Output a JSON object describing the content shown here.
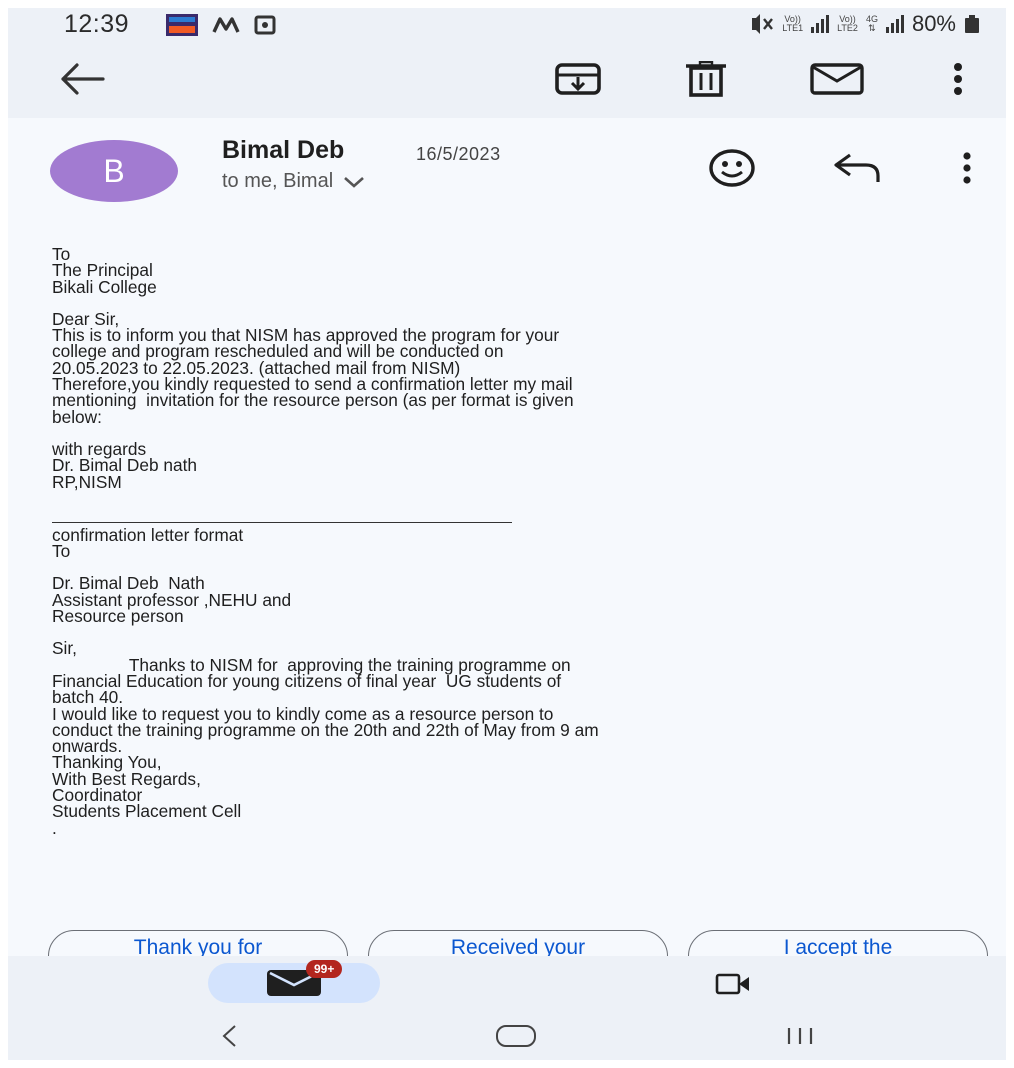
{
  "status_bar": {
    "time": "12:39",
    "network_top_1": "Vo))",
    "network_bottom_1": "LTE1",
    "network_top_2": "Vo))",
    "network_bottom_2": "LTE2",
    "network_gen": "4G",
    "battery_percent": "80%"
  },
  "toolbar": {
    "icons": [
      "back-arrow-icon",
      "archive-icon",
      "delete-icon",
      "mark-unread-icon",
      "more-vert-icon"
    ]
  },
  "message": {
    "avatar_letter": "B",
    "avatar_color": "#a27bd1",
    "sender": "Bimal Deb",
    "date": "16/5/2023",
    "recipients": "to me, Bimal",
    "body": [
      "To",
      "The Principal",
      "Bikali College",
      "",
      "Dear Sir,",
      "This is to inform you that NISM has approved the program for your",
      "college and program rescheduled and will be conducted on",
      "20.05.2023 to 22.05.2023. (attached mail from NISM)",
      "Therefore,you kindly requested to send a confirmation letter my mail",
      "mentioning  invitation for the resource person (as per format is given",
      "below:",
      "",
      "with regards",
      "Dr. Bimal Deb nath",
      "RP,NISM",
      "",
      "__RULE__",
      "confirmation letter format",
      "To",
      "",
      "Dr. Bimal Deb  Nath",
      "Assistant professor ,NEHU and",
      "Resource person",
      "",
      "Sir,",
      "                Thanks to NISM for  approving the training programme on",
      "Financial Education for young citizens of final year  UG students of",
      "batch 40.",
      "I would like to request you to kindly come as a resource person to",
      "conduct the training programme on the 20th and 22th of May from 9 am",
      "onwards.",
      "Thanking You,",
      "With Best Regards,",
      "Coordinator",
      "Students Placement Cell",
      "."
    ]
  },
  "smart_replies": [
    "Thank you for",
    "Received your",
    "I accept the"
  ],
  "bottom_nav": {
    "mail_badge": "99+",
    "accent": "#d3e3fd",
    "badge_color": "#b3261e"
  },
  "link_color": "#0b57d0"
}
